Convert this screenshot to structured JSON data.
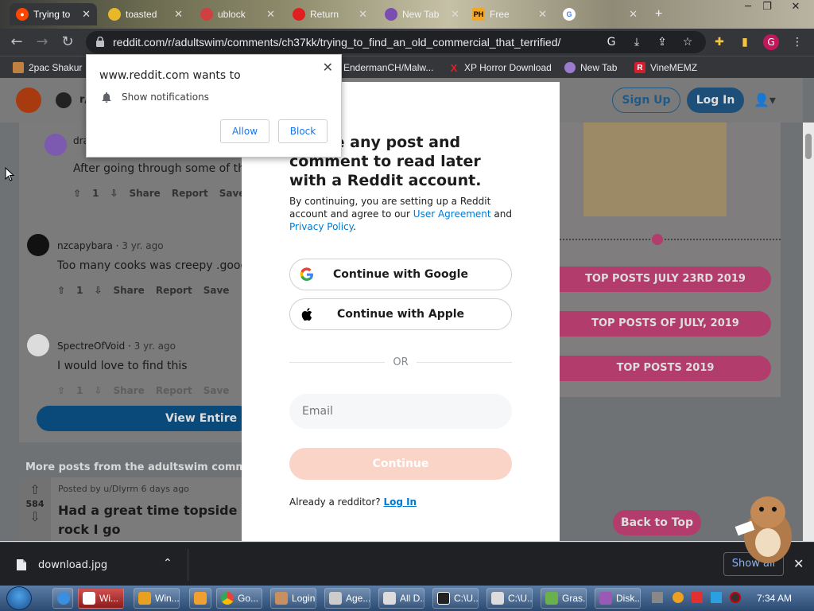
{
  "browser": {
    "tabs": [
      {
        "title": "Trying to",
        "active": true,
        "color": "#ff4500"
      },
      {
        "title": "toasted",
        "active": false,
        "color": "#e8b828"
      },
      {
        "title": "ublock",
        "active": false,
        "color": "#d04040"
      },
      {
        "title": "Return",
        "active": false,
        "color": "#e02020"
      },
      {
        "title": "New Tab",
        "active": false,
        "color": "#7a4db0"
      },
      {
        "title": "Free",
        "active": false,
        "color": "#f5a623"
      },
      {
        "title": "",
        "active": false,
        "color": "#4285f4"
      }
    ],
    "url": "reddit.com/r/adultswim/comments/ch37kk/trying_to_find_an_old_commercial_that_terrified/",
    "bookmarks": [
      {
        "label": "2pac Shakur",
        "color": "#c08040"
      },
      {
        "label": "EndermanCH/Malw...",
        "color": "#cccccc"
      },
      {
        "label": "XP Horror Download",
        "color": "#e02020"
      },
      {
        "label": "New Tab",
        "color": "#9b7bd0"
      },
      {
        "label": "VineMEMZ",
        "color": "#d02030"
      }
    ],
    "profile_initial": "G"
  },
  "reddit": {
    "header": {
      "signup": "Sign Up",
      "login": "Log In",
      "sub_prefix": "r/"
    },
    "comments": [
      {
        "user": "dra",
        "age": "",
        "text": "After going through some of the",
        "votes": "1"
      },
      {
        "user": "nzcapybara",
        "age": "3 yr. ago",
        "text": "Too many cooks was creepy .good l",
        "votes": "1"
      },
      {
        "user": "SpectreOfVoid",
        "age": "3 yr. ago",
        "text": "I would love to find this",
        "votes": "1"
      }
    ],
    "actions": {
      "share": "Share",
      "report": "Report",
      "save": "Save"
    },
    "view_all": "View Entire Di",
    "more_posts": "More posts from the adultswim community",
    "post": {
      "meta": "Posted by u/Dlyrm 6 days ago",
      "title_1": "Had a great time topside tod",
      "title_2": "rock I go",
      "votes": "584"
    },
    "sidebar": {
      "pills": [
        "TOP POSTS JULY 23RD 2019",
        "TOP POSTS OF JULY, 2019",
        "TOP POSTS 2019"
      ],
      "back_to_top": "Back to Top"
    }
  },
  "modal": {
    "headline": "n save any post and comment to read later with a Reddit account.",
    "legal_prefix": "By continuing, you are setting up a Reddit account and agree to our ",
    "user_agreement": "User Agreement",
    "legal_and": " and ",
    "privacy_policy": "Privacy Policy",
    "legal_suffix": ".",
    "google": "Continue with Google",
    "apple": "Continue with Apple",
    "or": "OR",
    "email_placeholder": "Email",
    "continue": "Continue",
    "already": "Already a redditor? ",
    "login_link": "Log In"
  },
  "notification": {
    "site": "www.reddit.com wants to",
    "message": "Show notifications",
    "allow": "Allow",
    "block": "Block"
  },
  "downloads": {
    "file": "download.jpg",
    "show_all": "Show all"
  },
  "taskbar": {
    "items": [
      "Wi...",
      "Win...",
      "",
      "Go...",
      "Login",
      "Age...",
      "All D...",
      "C:\\U...",
      "C:\\U...",
      "Gras...",
      "Disk..."
    ],
    "time": "7:34 AM"
  }
}
